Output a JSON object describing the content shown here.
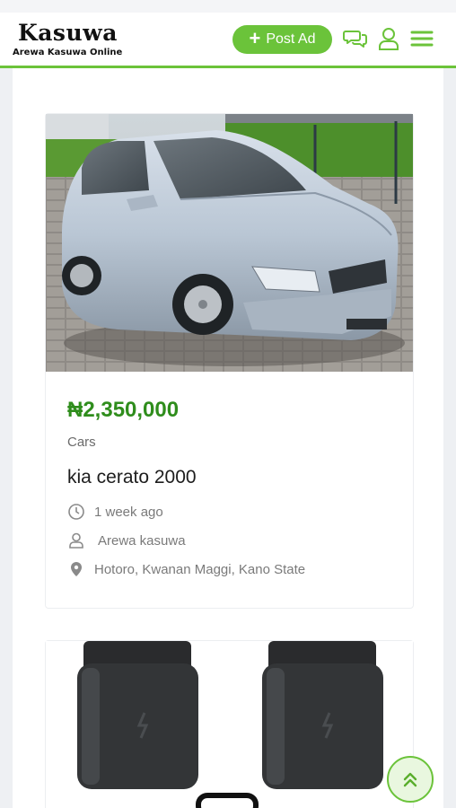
{
  "header": {
    "logo_title": "Kasuwa",
    "logo_subtitle": "Arewa Kasuwa Online",
    "post_ad_label": "Post Ad",
    "icons": [
      "chat-icon",
      "user-icon",
      "menu-icon"
    ]
  },
  "listings": [
    {
      "price": "₦2,350,000",
      "category": "Cars",
      "title": "kia cerato 2000",
      "posted": "1 week ago",
      "seller": "Arewa kasuwa",
      "location": "Hotoro, Kwanan Maggi, Kano State",
      "image": "silver-hatchback-car-photo"
    },
    {
      "image": "black-phone-charger-adapters-photo"
    }
  ],
  "colors": {
    "accent": "#6bc33a",
    "price": "#2f8d1c"
  }
}
